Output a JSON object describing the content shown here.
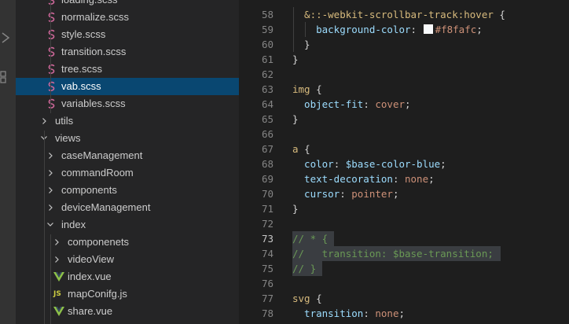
{
  "explorer": {
    "items": [
      {
        "label": "loading.scss",
        "type": "file",
        "icon": "sass-icon",
        "depth": 2,
        "selected": false
      },
      {
        "label": "normalize.scss",
        "type": "file",
        "icon": "sass-icon",
        "depth": 2,
        "selected": false
      },
      {
        "label": "style.scss",
        "type": "file",
        "icon": "sass-icon",
        "depth": 2,
        "selected": false
      },
      {
        "label": "transition.scss",
        "type": "file",
        "icon": "sass-icon",
        "depth": 2,
        "selected": false
      },
      {
        "label": "tree.scss",
        "type": "file",
        "icon": "sass-icon",
        "depth": 2,
        "selected": false
      },
      {
        "label": "vab.scss",
        "type": "file",
        "icon": "sass-icon",
        "depth": 2,
        "selected": true
      },
      {
        "label": "variables.scss",
        "type": "file",
        "icon": "sass-icon",
        "depth": 2,
        "selected": false
      },
      {
        "label": "utils",
        "type": "folder",
        "expanded": false,
        "depth": 1
      },
      {
        "label": "views",
        "type": "folder",
        "expanded": true,
        "depth": 1
      },
      {
        "label": "caseManagement",
        "type": "folder",
        "expanded": false,
        "depth": 2
      },
      {
        "label": "commandRoom",
        "type": "folder",
        "expanded": false,
        "depth": 2
      },
      {
        "label": "components",
        "type": "folder",
        "expanded": false,
        "depth": 2
      },
      {
        "label": "deviceManagement",
        "type": "folder",
        "expanded": false,
        "depth": 2
      },
      {
        "label": "index",
        "type": "folder",
        "expanded": true,
        "depth": 2
      },
      {
        "label": "componenets",
        "type": "folder",
        "expanded": false,
        "depth": 3
      },
      {
        "label": "videoView",
        "type": "folder",
        "expanded": false,
        "depth": 3
      },
      {
        "label": "index.vue",
        "type": "file",
        "icon": "vue-icon",
        "depth": 3,
        "selected": false
      },
      {
        "label": "mapConifg.js",
        "type": "file",
        "icon": "js-icon",
        "iconText": "JS",
        "depth": 3,
        "selected": false
      },
      {
        "label": "share.vue",
        "type": "file",
        "icon": "vue-icon",
        "depth": 3,
        "selected": false
      }
    ]
  },
  "editor": {
    "colors": {
      "background": "#1e1e1e",
      "swatch": "#f8fafc"
    },
    "lines": [
      {
        "num": "58",
        "tokens": [
          [
            "sel",
            "  &::-webkit-scrollbar-track:hover "
          ],
          [
            "pun",
            "{"
          ]
        ]
      },
      {
        "num": "59",
        "tokens": [
          [
            "prop",
            "    background-color"
          ],
          [
            "pun",
            ": "
          ],
          [
            "swatch",
            ""
          ],
          [
            "val",
            "#f8fafc"
          ],
          [
            "pun",
            ";"
          ]
        ]
      },
      {
        "num": "60",
        "tokens": [
          [
            "pun",
            "  }"
          ]
        ]
      },
      {
        "num": "61",
        "tokens": [
          [
            "pun",
            "}"
          ]
        ]
      },
      {
        "num": "62",
        "tokens": []
      },
      {
        "num": "63",
        "tokens": [
          [
            "sel",
            "img "
          ],
          [
            "pun",
            "{"
          ]
        ]
      },
      {
        "num": "64",
        "tokens": [
          [
            "prop",
            "  object-fit"
          ],
          [
            "pun",
            ": "
          ],
          [
            "val",
            "cover"
          ],
          [
            "pun",
            ";"
          ]
        ]
      },
      {
        "num": "65",
        "tokens": [
          [
            "pun",
            "}"
          ]
        ]
      },
      {
        "num": "66",
        "tokens": []
      },
      {
        "num": "67",
        "tokens": [
          [
            "sel",
            "a "
          ],
          [
            "pun",
            "{"
          ]
        ]
      },
      {
        "num": "68",
        "tokens": [
          [
            "prop",
            "  color"
          ],
          [
            "pun",
            ": "
          ],
          [
            "var",
            "$base-color-blue"
          ],
          [
            "pun",
            ";"
          ]
        ]
      },
      {
        "num": "69",
        "tokens": [
          [
            "prop",
            "  text-decoration"
          ],
          [
            "pun",
            ": "
          ],
          [
            "val",
            "none"
          ],
          [
            "pun",
            ";"
          ]
        ]
      },
      {
        "num": "70",
        "tokens": [
          [
            "prop",
            "  cursor"
          ],
          [
            "pun",
            ": "
          ],
          [
            "val",
            "pointer"
          ],
          [
            "pun",
            ";"
          ]
        ]
      },
      {
        "num": "71",
        "tokens": [
          [
            "pun",
            "}"
          ]
        ]
      },
      {
        "num": "72",
        "tokens": []
      },
      {
        "num": "73",
        "tokens": [
          [
            "com",
            "// * {"
          ]
        ],
        "current": true
      },
      {
        "num": "74",
        "tokens": [
          [
            "com",
            "//   transition: $base-transition;"
          ]
        ]
      },
      {
        "num": "75",
        "tokens": [
          [
            "com",
            "// }"
          ]
        ]
      },
      {
        "num": "76",
        "tokens": []
      },
      {
        "num": "77",
        "tokens": [
          [
            "sel",
            "svg "
          ],
          [
            "pun",
            "{"
          ]
        ]
      },
      {
        "num": "78",
        "tokens": [
          [
            "prop",
            "  transition"
          ],
          [
            "pun",
            ": "
          ],
          [
            "val",
            "none"
          ],
          [
            "pun",
            ";"
          ]
        ]
      }
    ]
  }
}
